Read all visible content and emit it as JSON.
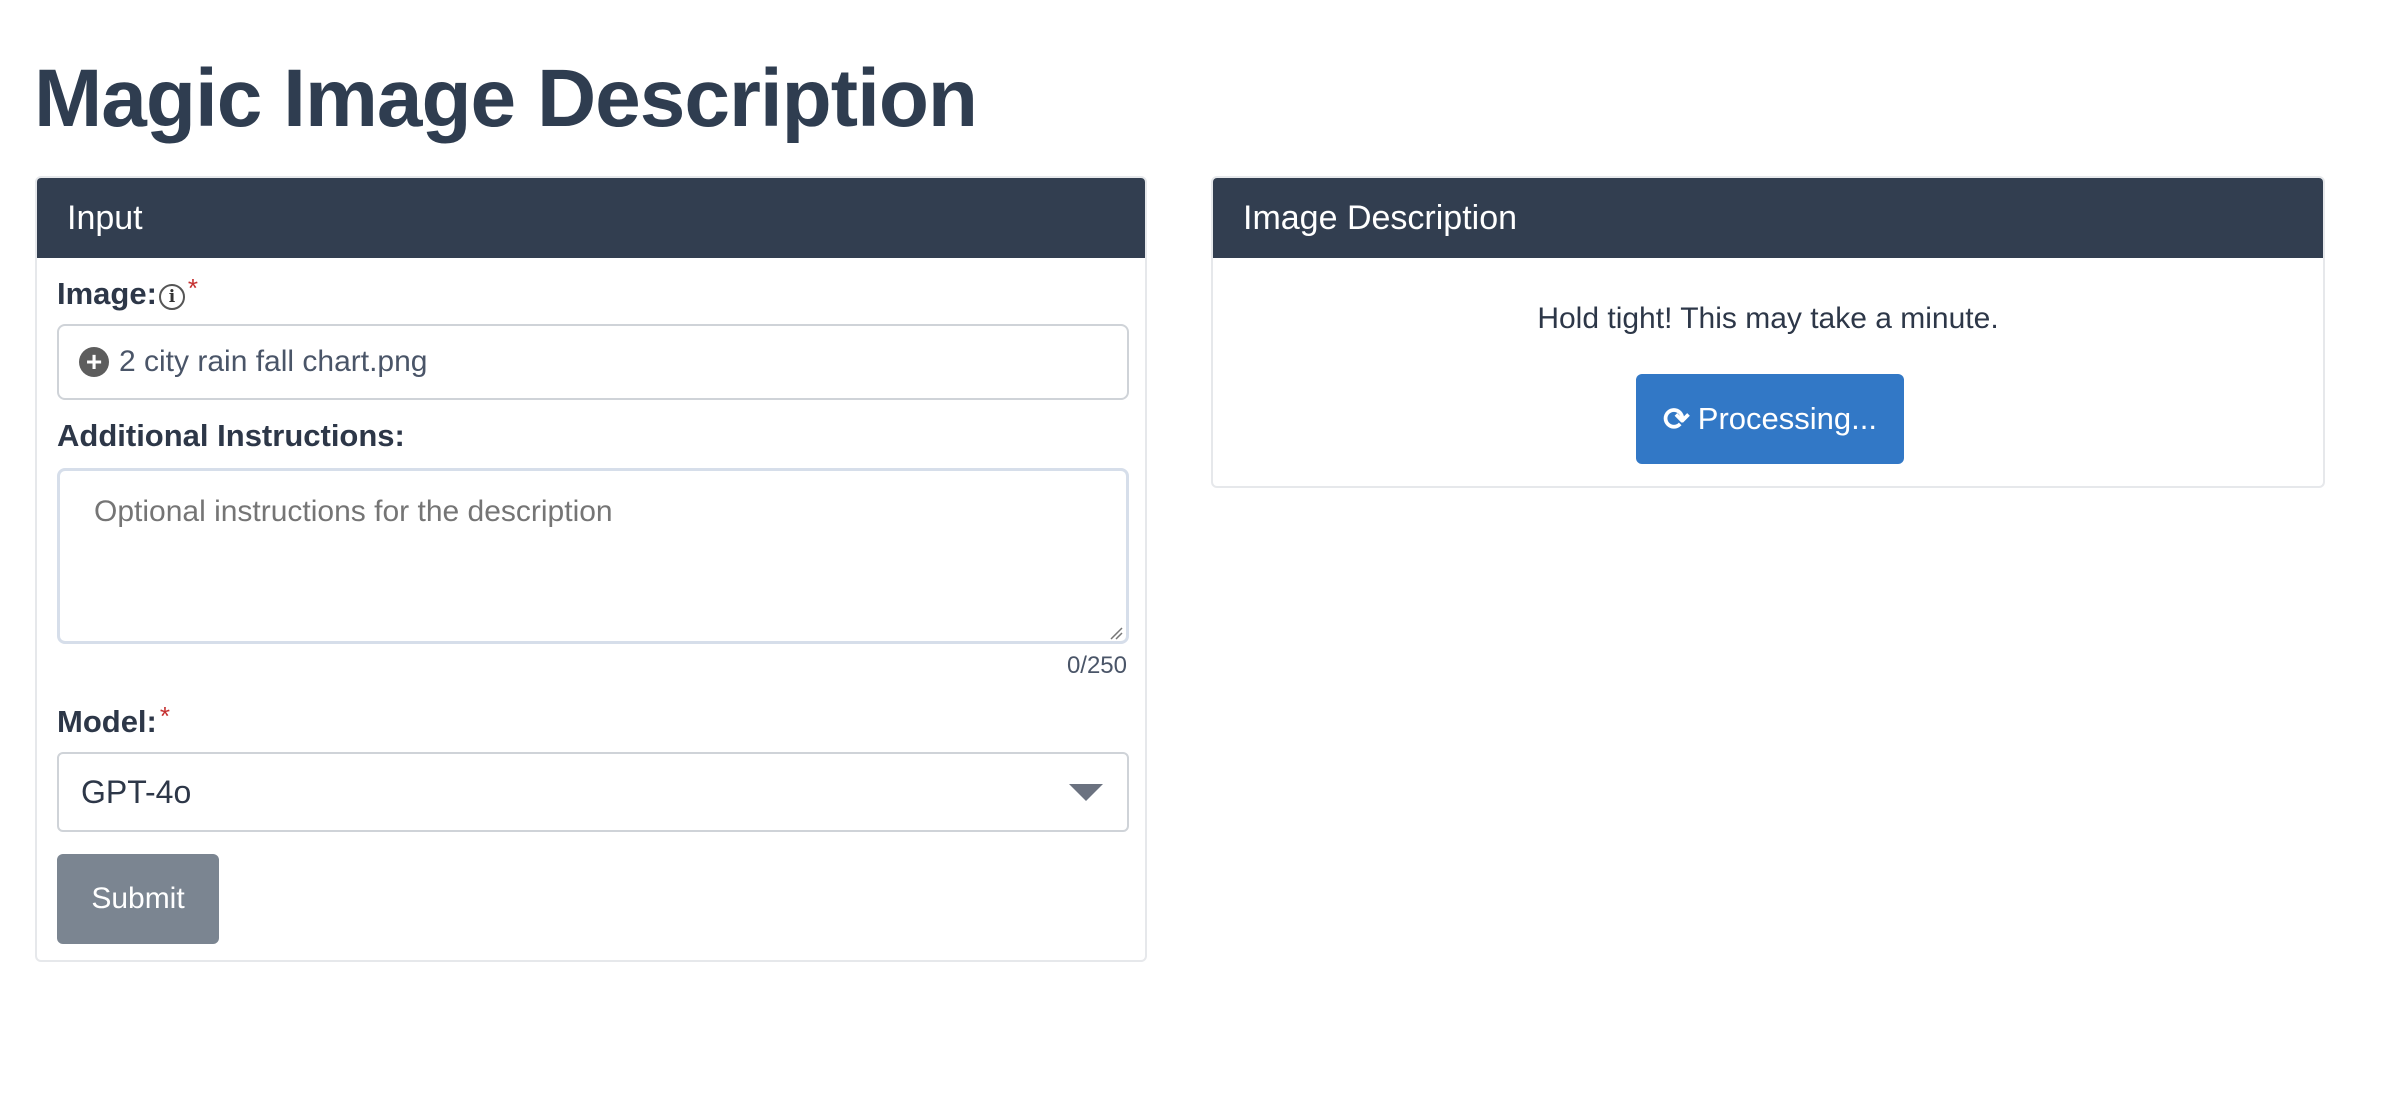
{
  "page": {
    "title": "Magic Image Description"
  },
  "input_panel": {
    "header": "Input",
    "image_label": "Image:",
    "image_required": "*",
    "image_info_icon": "info-icon",
    "file_icon": "plus-circle-icon",
    "file_name": "2 city rain fall chart.png",
    "instructions_label": "Additional Instructions:",
    "instructions_value": "",
    "instructions_placeholder": "Optional instructions for the description",
    "char_count": "0/250",
    "model_label": "Model:",
    "model_required": "*",
    "model_selected": "GPT-4o",
    "submit_label": "Submit"
  },
  "description_panel": {
    "header": "Image Description",
    "status_text": "Hold tight! This may take a minute.",
    "processing_icon": "refresh-icon",
    "processing_label": "Processing..."
  },
  "colors": {
    "header_bg": "#323e50",
    "processing_button": "#3278c6",
    "submit_button": "#7b8591",
    "required_star": "#c53030"
  }
}
